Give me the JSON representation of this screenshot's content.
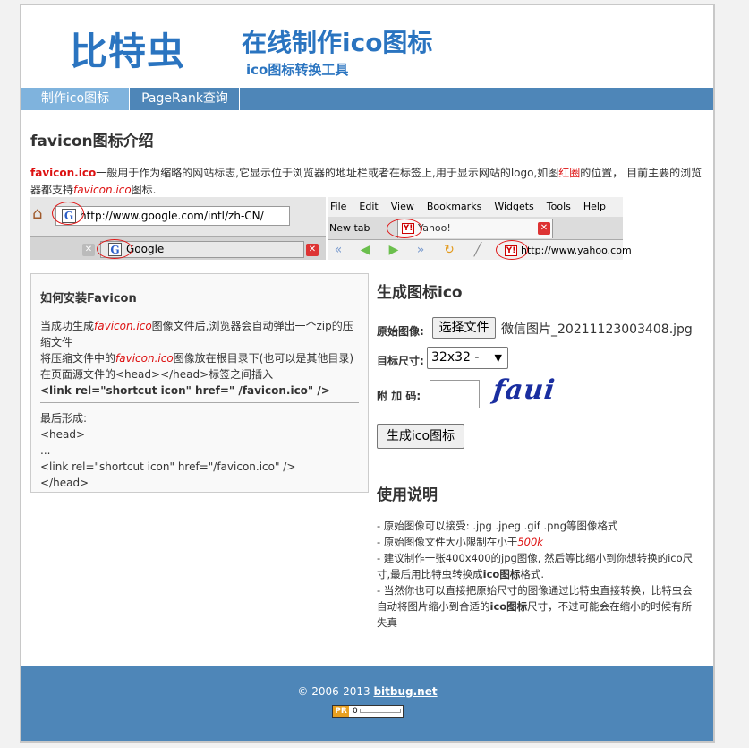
{
  "header": {
    "logo": "比特虫",
    "slogan": "在线制作ico图标",
    "subslogan": "ico图标转换工具"
  },
  "nav": {
    "items": [
      {
        "label": "制作ico图标",
        "active": true
      },
      {
        "label": "PageRank查询",
        "active": false
      }
    ]
  },
  "intro": {
    "title": "favicon图标介绍",
    "text_part1": "favicon.ico",
    "text_part2": "一般用于作为缩略的网站标志,它显示位于浏览器的地址栏或者在标签上,用于显示网站的logo,如图",
    "text_part3": "红圈",
    "text_part4": "的位置， 目前主要的浏览器都支持",
    "text_part5": "favicon.ico",
    "text_part6": "图标."
  },
  "browser_demo": {
    "ff_url": "http://www.google.com/intl/zh-CN/",
    "ff_tab": "Google",
    "ie_menu": [
      "File",
      "Edit",
      "View",
      "Bookmarks",
      "Widgets",
      "Tools",
      "Help"
    ],
    "ie_newtab": "New tab",
    "ie_tab": "Yahoo!",
    "ie_url": "http://www.yahoo.com",
    "icons": {
      "g": "G",
      "y": "Y!",
      "close": "✕",
      "home": "⌂"
    }
  },
  "install": {
    "title": "如何安装Favicon",
    "line1_a": "当成功生成",
    "line1_b": "favicon.ico",
    "line1_c": "图像文件后,浏览器会自动弹出一个zip的压缩文件",
    "line2_a": "将压缩文件中的",
    "line2_b": "favicon.ico",
    "line2_c": "图像放在根目录下(也可以是其他目录)",
    "line3": "在页面源文件的<head></head>标签之间插入",
    "code": "<link rel=\"shortcut icon\" href=\" /favicon.ico\" />",
    "result_title": "最后形成:",
    "result_lines": [
      "<head>",
      "...",
      "<link rel=\"shortcut icon\" href=\"/favicon.ico\" />",
      "</head>"
    ]
  },
  "generate": {
    "title": "生成图标ico",
    "original_label": "原始图像:",
    "file_button": "选择文件",
    "file_name": "微信图片_20211123003408.jpg",
    "size_label": "目标尺寸:",
    "size_value": "32x32 -",
    "captcha_label": "附 加 码:",
    "captcha_text": "faui",
    "submit": "生成ico图标"
  },
  "usage": {
    "title": "使用说明",
    "line1": "- 原始图像可以接受: .jpg .jpeg .gif .png等图像格式",
    "line2_a": "- 原始图像文件大小限制在小于",
    "line2_b": "500k",
    "line3_a": "- 建议制作一张400x400的jpg图像, 然后等比缩小到你想转换的ico尺寸,最后用比特虫转换成",
    "line3_b": "ico图标",
    "line3_c": "格式.",
    "line4_a": "- 当然你也可以直接把原始尺寸的图像通过比特虫直接转换，比特虫会自动将图片缩小到合适的",
    "line4_b": "ico图标",
    "line4_c": "尺寸，不过可能会在缩小的时候有所失真"
  },
  "footer": {
    "copyright": "© 2006-2013 ",
    "site": "bitbug.net",
    "pr_label": "PR",
    "pr_value": "0",
    "pr_fraction": 0
  },
  "colors": {
    "brand_blue": "#2a74c0",
    "nav_bg": "#4e86b8",
    "nav_active": "#7fb3dd",
    "highlight_red": "#d11"
  }
}
